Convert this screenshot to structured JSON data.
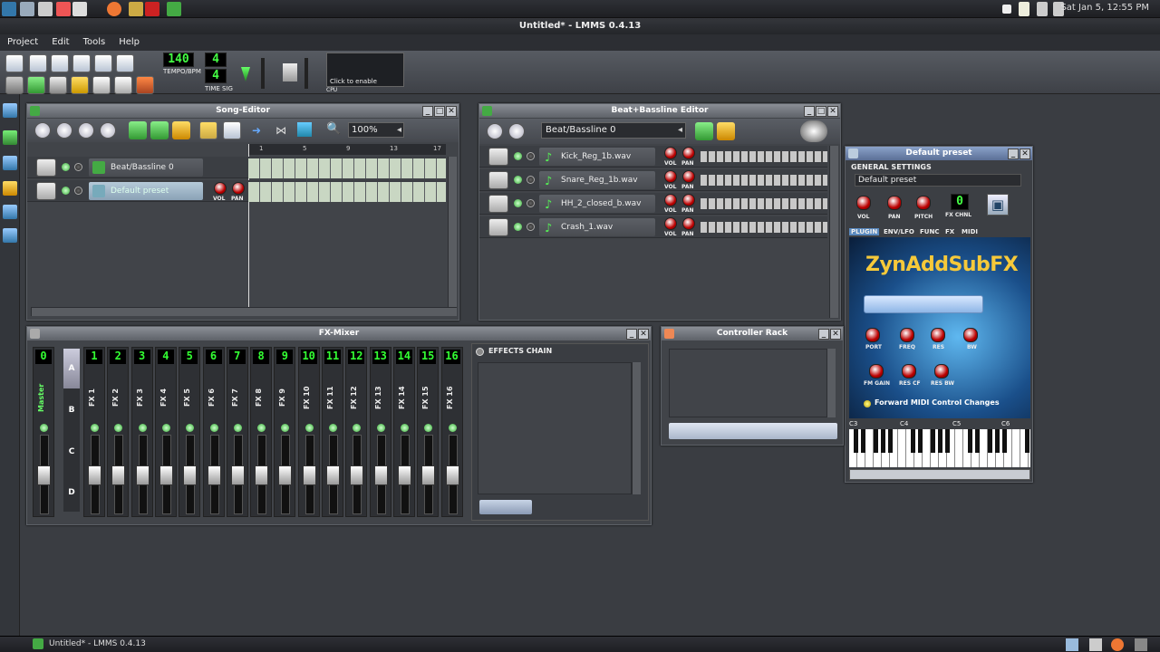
{
  "system": {
    "clock": "Sat Jan  5, 12:55 PM"
  },
  "window": {
    "title": "Untitled* - LMMS 0.4.13"
  },
  "menu": [
    "Project",
    "Edit",
    "Tools",
    "Help"
  ],
  "toolbar": {
    "tempo": "140",
    "tempo_label": "TEMPO/BPM",
    "timesig_num": "4",
    "timesig_den": "4",
    "timesig_label": "TIME SIG",
    "cpu_hint": "Click to enable",
    "cpu_label": "CPU"
  },
  "song_editor": {
    "title": "Song-Editor",
    "zoom": "100%",
    "ruler": [
      "1",
      "5",
      "9",
      "13",
      "17"
    ],
    "tracks": [
      {
        "name": "Beat/Bassline 0"
      },
      {
        "name": "Default preset",
        "vol": "VOL",
        "pan": "PAN"
      }
    ]
  },
  "beat_editor": {
    "title": "Beat+Bassline Editor",
    "selected": "Beat/Bassline 0",
    "tracks": [
      "Kick_Reg_1b.wav",
      "Snare_Reg_1b.wav",
      "HH_2_closed_b.wav",
      "Crash_1.wav"
    ],
    "vol": "VOL",
    "pan": "PAN"
  },
  "fx_mixer": {
    "title": "FX-Mixer",
    "master_num": "0",
    "master": "Master",
    "banks": [
      "A",
      "B",
      "C",
      "D"
    ],
    "effects_chain": "EFFECTS CHAIN",
    "channels": [
      {
        "num": "1",
        "name": "FX 1"
      },
      {
        "num": "2",
        "name": "FX 2"
      },
      {
        "num": "3",
        "name": "FX 3"
      },
      {
        "num": "4",
        "name": "FX 4"
      },
      {
        "num": "5",
        "name": "FX 5"
      },
      {
        "num": "6",
        "name": "FX 6"
      },
      {
        "num": "7",
        "name": "FX 7"
      },
      {
        "num": "8",
        "name": "FX 8"
      },
      {
        "num": "9",
        "name": "FX 9"
      },
      {
        "num": "10",
        "name": "FX 10"
      },
      {
        "num": "11",
        "name": "FX 11"
      },
      {
        "num": "12",
        "name": "FX 12"
      },
      {
        "num": "13",
        "name": "FX 13"
      },
      {
        "num": "14",
        "name": "FX 14"
      },
      {
        "num": "15",
        "name": "FX 15"
      },
      {
        "num": "16",
        "name": "FX 16"
      }
    ]
  },
  "controller_rack": {
    "title": "Controller Rack"
  },
  "instrument": {
    "title": "Default preset",
    "general": "GENERAL SETTINGS",
    "preset_name": "Default preset",
    "knobs": [
      "VOL",
      "PAN",
      "PITCH"
    ],
    "fx_channel": "0",
    "fx_chnl_label": "FX CHNL",
    "tabs": [
      "PLUGIN",
      "ENV/LFO",
      "FUNC",
      "FX",
      "MIDI"
    ],
    "plugin_name": "ZynAddSubFX",
    "params1": [
      "PORT",
      "FREQ",
      "RES",
      "BW"
    ],
    "params2": [
      "FM GAIN",
      "RES CF",
      "RES BW"
    ],
    "midi_forward": "Forward MIDI Control Changes",
    "octaves": [
      "C3",
      "C4",
      "C5",
      "C6"
    ]
  },
  "taskbar": {
    "task": "Untitled* - LMMS 0.4.13"
  }
}
